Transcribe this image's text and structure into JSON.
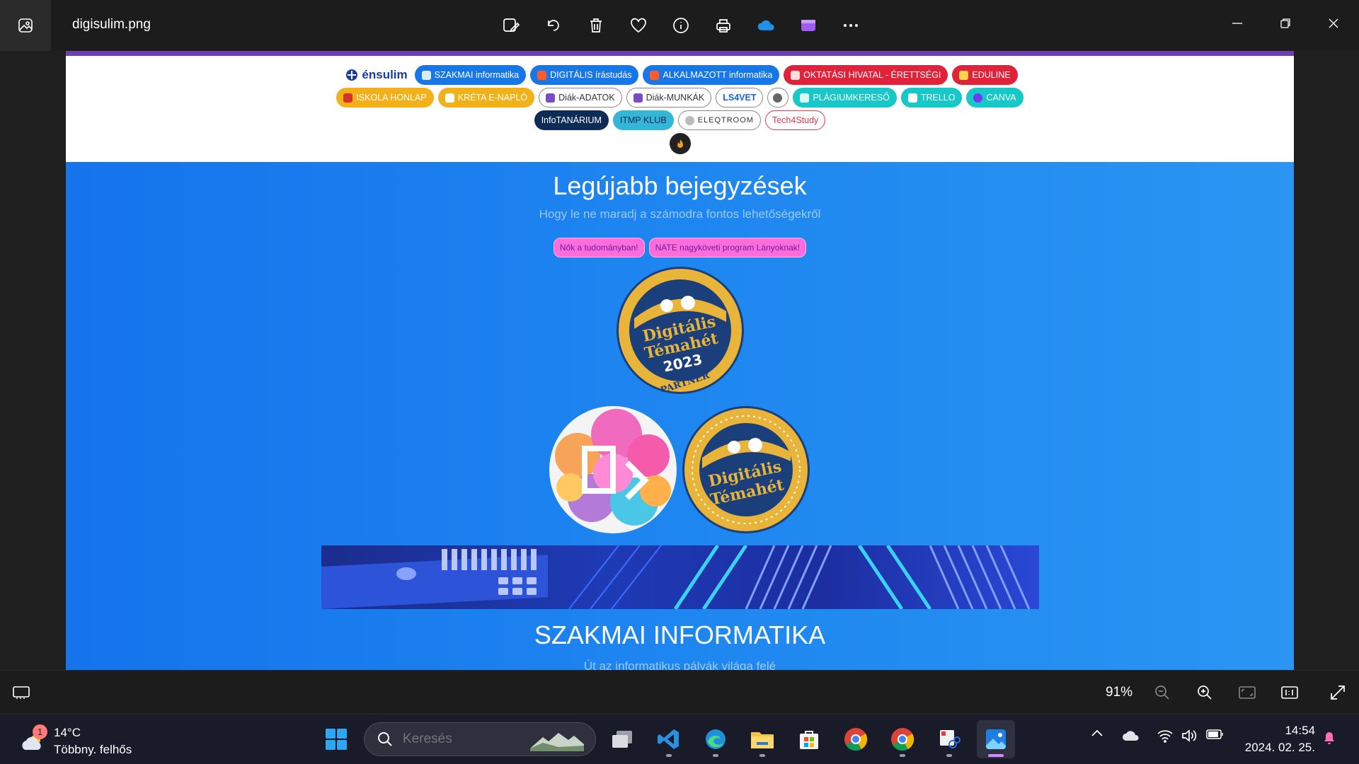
{
  "window": {
    "file_name": "digisulim.png",
    "toolbar_icons": [
      "edit-image-icon",
      "rotate-icon",
      "delete-icon",
      "favorite-icon",
      "info-icon",
      "print-icon",
      "onedrive-icon",
      "clipchamp-icon",
      "more-icon"
    ],
    "controls": [
      "minimize-icon",
      "restore-icon",
      "close-icon"
    ]
  },
  "webpage": {
    "logo": "énsulim",
    "links_row1": [
      "SZAKMAI informatika",
      "DIGITÁLIS írástudás",
      "ALKALMAZOTT informatika",
      "OKTATÁSI HIVATAL - ÉRETTSÉGI",
      "EDULINE"
    ],
    "links_row2": [
      "ISKOLA HONLAP",
      "KRÉTA E-NAPLÓ",
      "Diák-ADATOK",
      "Diák-MUNKÁK",
      "LS4VET",
      "",
      "PLÁGIUMKERESŐ",
      "TRELLO",
      "CANVA"
    ],
    "links_row3": [
      "InfoTANÁRIUM",
      "ITMP KLUB",
      "ELEQTROOM",
      "Tech4Study"
    ],
    "section1_title": "Legújabb bejegyzések",
    "section1_subtitle": "Hogy le ne maradj a számodra fontos lehetőségekről",
    "tags": [
      "Nők a tudományban!",
      "NATE nagyköveti program Lányoknak!"
    ],
    "badge_main": {
      "line1": "Digitális",
      "line2": "Témahét",
      "year": "2023",
      "ribbon": "PARTNER"
    },
    "badge_small": {
      "line1": "Digitális",
      "line2": "Témahét"
    },
    "section2_title": "SZAKMAI INFORMATIKA",
    "section2_subtitle": "Út az informatikus pályák világa felé"
  },
  "viewbar": {
    "zoom": "91%",
    "icons": [
      "filmstrip-icon",
      "zoom-out-icon",
      "zoom-in-icon",
      "fit-to-window-icon",
      "actual-size-icon",
      "fullscreen-icon"
    ]
  },
  "taskbar": {
    "weather_temp": "14°C",
    "weather_desc": "Többny. felhős",
    "weather_badge": "1",
    "search_placeholder": "Keresés",
    "apps": [
      "start-icon",
      "task-view-icon",
      "vscode-icon",
      "edge-icon",
      "file-explorer-icon",
      "store-icon",
      "chrome-icon",
      "chrome-profile-icon",
      "snipping-tool-icon",
      "photos-icon"
    ],
    "tray": [
      "show-hidden-icon",
      "onedrive-tray-icon",
      "wifi-icon",
      "volume-icon",
      "battery-icon"
    ],
    "time": "14:54",
    "date": "2024. 02. 25."
  },
  "colors": {
    "page_blue": "#1e88ef",
    "header_purple": "#6d3fb0",
    "tag_pink": "#ff6ddc",
    "badge_gold": "#e9b43a",
    "badge_navy": "#1a3f7a"
  }
}
